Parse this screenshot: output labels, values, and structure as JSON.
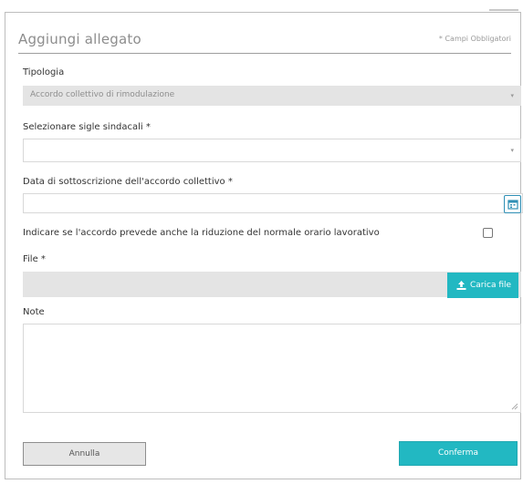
{
  "dialog": {
    "title": "Aggiungi allegato",
    "required_note": "* Campi Obbligatori"
  },
  "tipologia": {
    "label": "Tipologia",
    "value": "Accordo collettivo di rimodulazione"
  },
  "sigle": {
    "label": "Selezionare sigle sindacali *",
    "value": ""
  },
  "data_sottoscrizione": {
    "label": "Data di sottoscrizione dell'accordo collettivo *",
    "value": "",
    "button_icon": "calendar-icon"
  },
  "riduzione_orario": {
    "label": "Indicare se l'accordo prevede anche la riduzione del normale orario lavorativo",
    "checked": false
  },
  "file": {
    "label": "File *",
    "value": "",
    "upload_label": "Carica file",
    "upload_icon": "upload-icon"
  },
  "note": {
    "label": "Note",
    "value": ""
  },
  "actions": {
    "cancel_label": "Annulla",
    "confirm_label": "Conferma"
  },
  "colors": {
    "accent": "#22b8c2",
    "calendar_border": "#2f8fb5",
    "disabled_field": "#e4e4e4"
  }
}
